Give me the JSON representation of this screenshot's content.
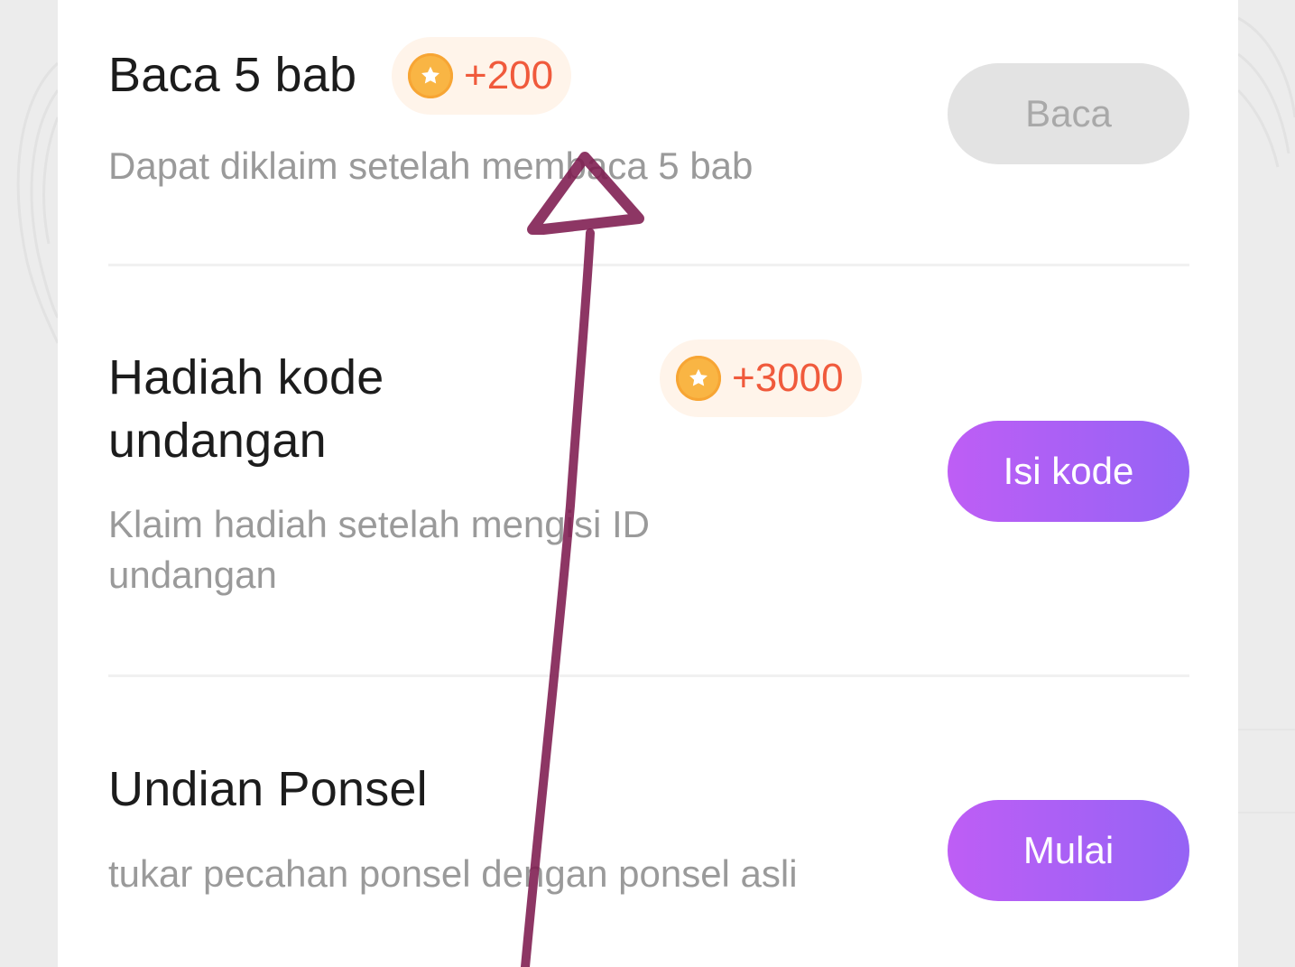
{
  "colors": {
    "primary_gradient_start": "#be5ef5",
    "primary_gradient_end": "#9563f5",
    "reward_text": "#f05a3c",
    "reward_badge_bg": "#fff4ea",
    "coin": "#f9b544",
    "disabled_button_bg": "#e3e3e3",
    "annotation_stroke": "#7d1a4e"
  },
  "tasks": [
    {
      "title": "Baca 5 bab",
      "reward": "+200",
      "reward_icon": "star-coin-icon",
      "description": "Dapat diklaim setelah membaca 5 bab",
      "button_label": "Baca",
      "button_state": "disabled"
    },
    {
      "title": "Hadiah kode undangan",
      "reward": "+3000",
      "reward_icon": "star-coin-icon",
      "description": "Klaim hadiah setelah mengisi ID undangan",
      "button_label": "Isi kode",
      "button_state": "active"
    },
    {
      "title": "Undian Ponsel",
      "description": "tukar pecahan ponsel dengan ponsel asli",
      "button_label": "Mulai",
      "button_state": "active"
    }
  ],
  "annotation": {
    "type": "hand-drawn-arrow",
    "direction": "up"
  }
}
